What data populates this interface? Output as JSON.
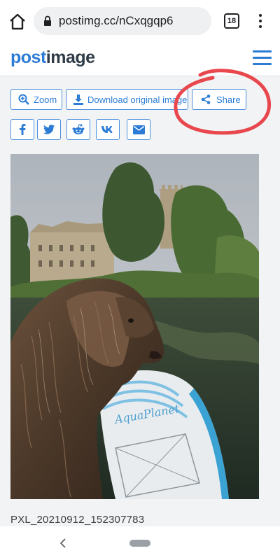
{
  "browser": {
    "url": "postimg.cc/nCxqgqp6",
    "tab_count": "18",
    "icons": [
      "home-icon",
      "lock-icon",
      "tabs-counter",
      "overflow-menu-icon"
    ]
  },
  "site": {
    "logo_part1": "post",
    "logo_part2": "image",
    "brand_color": "#2c7cd6",
    "menu_icon": "hamburger-icon"
  },
  "actions": {
    "zoom": "Zoom",
    "download": "Download original image",
    "share": "Share"
  },
  "social": [
    {
      "name": "facebook",
      "icon": "facebook-icon"
    },
    {
      "name": "twitter",
      "icon": "twitter-icon"
    },
    {
      "name": "reddit",
      "icon": "reddit-icon"
    },
    {
      "name": "vk",
      "icon": "vk-icon"
    },
    {
      "name": "email",
      "icon": "email-icon"
    }
  ],
  "image": {
    "board_text": "AquaPlanet"
  },
  "caption": "PXL_20210912_152307783",
  "annotation_color": "#e8474d"
}
